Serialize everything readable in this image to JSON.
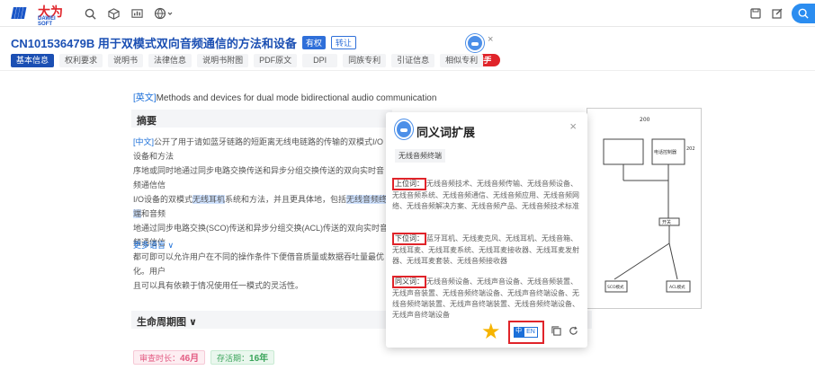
{
  "header": {
    "logo_cn": "大为",
    "logo_en": "DAWEI SOFT"
  },
  "patent": {
    "number_title": "CN101536479B  用于双模式双向音频通信的方法和设备",
    "badge_auth": "有权",
    "badge_invalid": "转让"
  },
  "tabs": [
    "基本信息",
    "权利要求",
    "说明书",
    "法律信息",
    "说明书附图",
    "PDF原文",
    "DPI",
    "同族专利",
    "引证信息",
    "相似专利"
  ],
  "ai_button": "AI助手",
  "content": {
    "en_tag": "[英文]",
    "en_title": "Methods and devices for dual mode bidirectional audio communication",
    "abstract_heading": "摘要",
    "abstract_tag": "[中文]",
    "abstract_p1": "公开了用于请如蓝牙链路的短距离无线电链路的传输的双模式I/O设备和方法",
    "abstract_p2": "序地或同时地通过同步电路交换传送和异步分组交换传送的双向实时音频通信信",
    "abstract_p3a": "I/O设备的双模式",
    "abstract_hl1": "无线耳机",
    "abstract_p3b": "系统和方法，并且更具体地，包括",
    "abstract_hl2": "无线音频终端",
    "abstract_p3c": "和音频",
    "abstract_p4": "地通过同步电路交换(SCO)传送和异步分组交换(ACL)传送的双向实时音频通信信",
    "abstract_p5": "都可即可以允许用户在不同的操作条件下便借音质量或数据吞吐量最优化。用户",
    "abstract_p6": "且可以具有依赖于情况使用任一模式的灵活性。",
    "more_lang": "更多语言 ∨",
    "lifecycle_heading": "生命周期图 ∨",
    "pill1_label": "审查时长：",
    "pill1_value": "46月",
    "pill2_label": "存活期：",
    "pill2_value": "16年"
  },
  "popup": {
    "title": "同义词扩展",
    "chip": "无线音频终端",
    "close": "×",
    "upper_label": "上位词：",
    "upper_text": "无线音频技术、无线音频传输、无线音频设备、无线音频系统、无线音频通信、无线音频应用、无线音频网络、无线音频解决方案、无线音频产品、无线音频技术标准",
    "lower_label": "下位词：",
    "lower_text": "蓝牙耳机、无线麦克风、无线耳机、无线音箱、无线耳麦、无线耳麦系统、无线耳麦接收器、无线耳麦发射器、无线耳麦套装、无线音频接收器",
    "syn_label": "同义词：",
    "syn_text": "无线音频设备、无线声音设备、无线音频装置、无线声音装置、无线音频终端设备、无线声音终端设备、无线音频终端装置、无线声音终端装置、无线音频终端设备、无线声音终端设备",
    "lang_cn": "中",
    "lang_en": "EN"
  },
  "colors": {
    "brand_blue": "#1b4fb3",
    "accent_red": "#e0242a",
    "link_blue": "#1b6fd9"
  }
}
